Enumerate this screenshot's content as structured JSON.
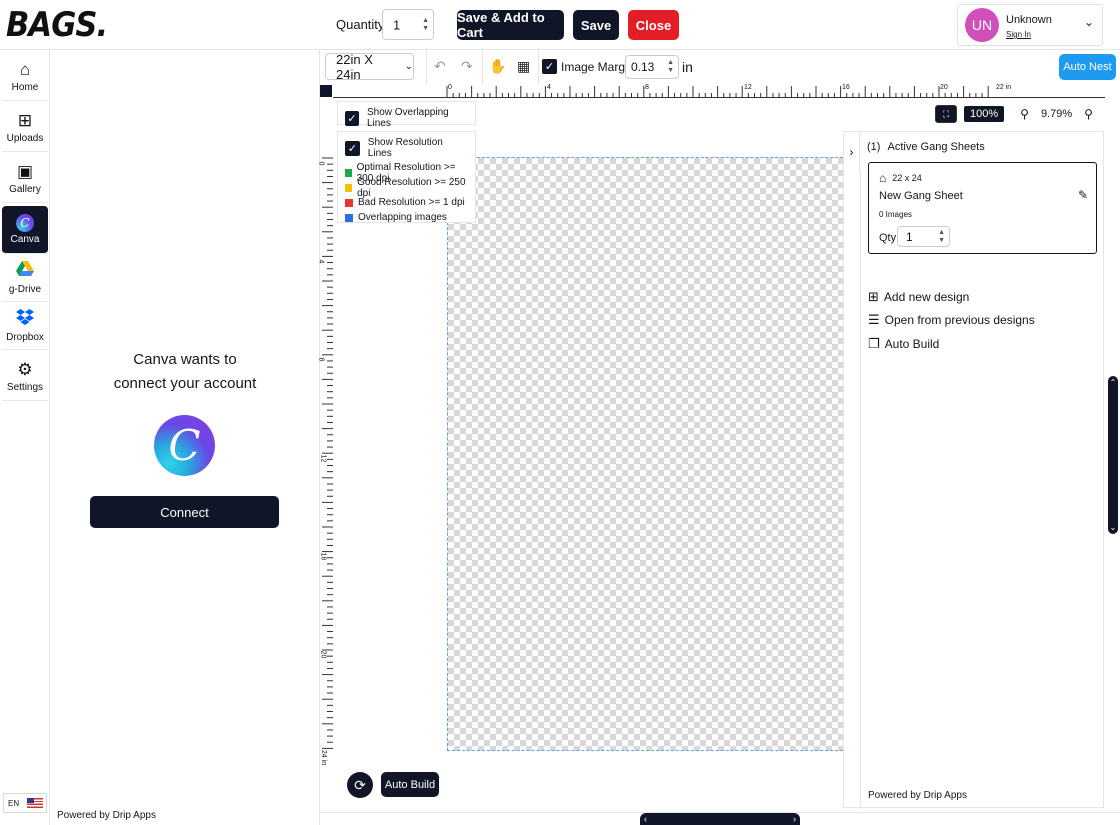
{
  "brand": {
    "logo_text": "BAGS."
  },
  "header": {
    "quantity_label": "Quantity:",
    "quantity_value": "1",
    "save_add_cart": "Save & Add to Cart",
    "save": "Save",
    "close": "Close",
    "user": {
      "initials": "UN",
      "name": "Unknown",
      "sign_in": "Sign In"
    }
  },
  "sidebar": {
    "items": [
      {
        "label": "Home",
        "icon": "home-icon"
      },
      {
        "label": "Uploads",
        "icon": "upload-icon"
      },
      {
        "label": "Gallery",
        "icon": "gallery-icon"
      },
      {
        "label": "Canva",
        "icon": "canva-icon"
      },
      {
        "label": "g-Drive",
        "icon": "gdrive-icon"
      },
      {
        "label": "Dropbox",
        "icon": "dropbox-icon"
      },
      {
        "label": "Settings",
        "icon": "gear-icon"
      }
    ],
    "language": "EN"
  },
  "canva_panel": {
    "title_line1": "Canva wants to",
    "title_line2": "connect your account",
    "logo_letter": "C",
    "connect": "Connect",
    "powered_prefix": "Powered by",
    "powered_brand": "Drip Apps"
  },
  "toolbar": {
    "sheet_size": "22in X 24in",
    "image_margin_label": "Image Margin",
    "image_margin_value": "0.13",
    "unit": "in",
    "auto_nest": "Auto Nest"
  },
  "canvas": {
    "show_overlapping": "Show Overlapping Lines",
    "show_resolution": "Show Resolution Lines",
    "legend": [
      {
        "label": "Optimal Resolution >= 300 dpi",
        "color": "#22a84a"
      },
      {
        "label": "Good Resolution >= 250 dpi",
        "color": "#f2c200"
      },
      {
        "label": "Bad Resolution >= 1 dpi",
        "color": "#e23a2e"
      },
      {
        "label": "Overlapping images",
        "color": "#2e6fe0"
      }
    ],
    "zoom_fit": "100%",
    "zoom_level": "9.79%",
    "ruler_h": [
      "0",
      "4",
      "8",
      "12",
      "16",
      "20",
      "22 in"
    ],
    "ruler_v": [
      "0",
      "4",
      "8",
      "12",
      "16",
      "20",
      "24 in"
    ],
    "auto_build": "Auto Build"
  },
  "right_panel": {
    "count": "(1)",
    "title": "Active Gang Sheets",
    "sheet": {
      "size": "22 x 24",
      "name": "New Gang Sheet",
      "images": "0 Images",
      "qty_label": "Qty:",
      "qty_value": "1"
    },
    "actions": [
      "Add new design",
      "Open from previous designs",
      "Auto Build"
    ],
    "powered_prefix": "Powered by",
    "powered_brand": "Drip Apps"
  }
}
